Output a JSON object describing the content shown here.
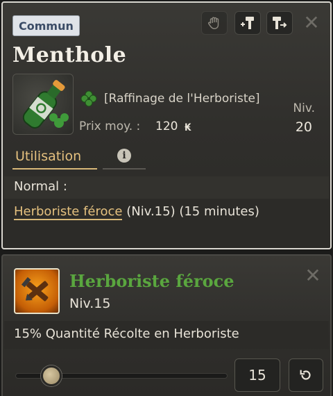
{
  "item": {
    "rarity": "Commun",
    "name": "Menthole",
    "job": "[Raffinage de l'Herboriste]",
    "price_label": "Prix moy. :",
    "price_value": "120",
    "currency_symbol": "₭",
    "level_label": "Niv.",
    "level_value": "20",
    "icons": [
      "hand-icon",
      "craft-hammer-icon",
      "recycle-hammer-icon",
      "close-icon",
      "clover-icon",
      "info-icon"
    ]
  },
  "tabs": {
    "usage": "Utilisation",
    "info": "i"
  },
  "usage": {
    "condition": "Normal :",
    "link": "Herboriste féroce",
    "detail": " (Niv.15) (15 minutes)"
  },
  "buff": {
    "name": "Herboriste féroce",
    "level": "Niv.15",
    "effect": "15% Quantité Récolte en Herboriste",
    "quantity": "15",
    "slider_fraction": 0.17
  },
  "colors": {
    "accent_gold": "#d8b878",
    "buff_green": "#5aa63f",
    "rarity_bg": "#dfe3e8"
  }
}
